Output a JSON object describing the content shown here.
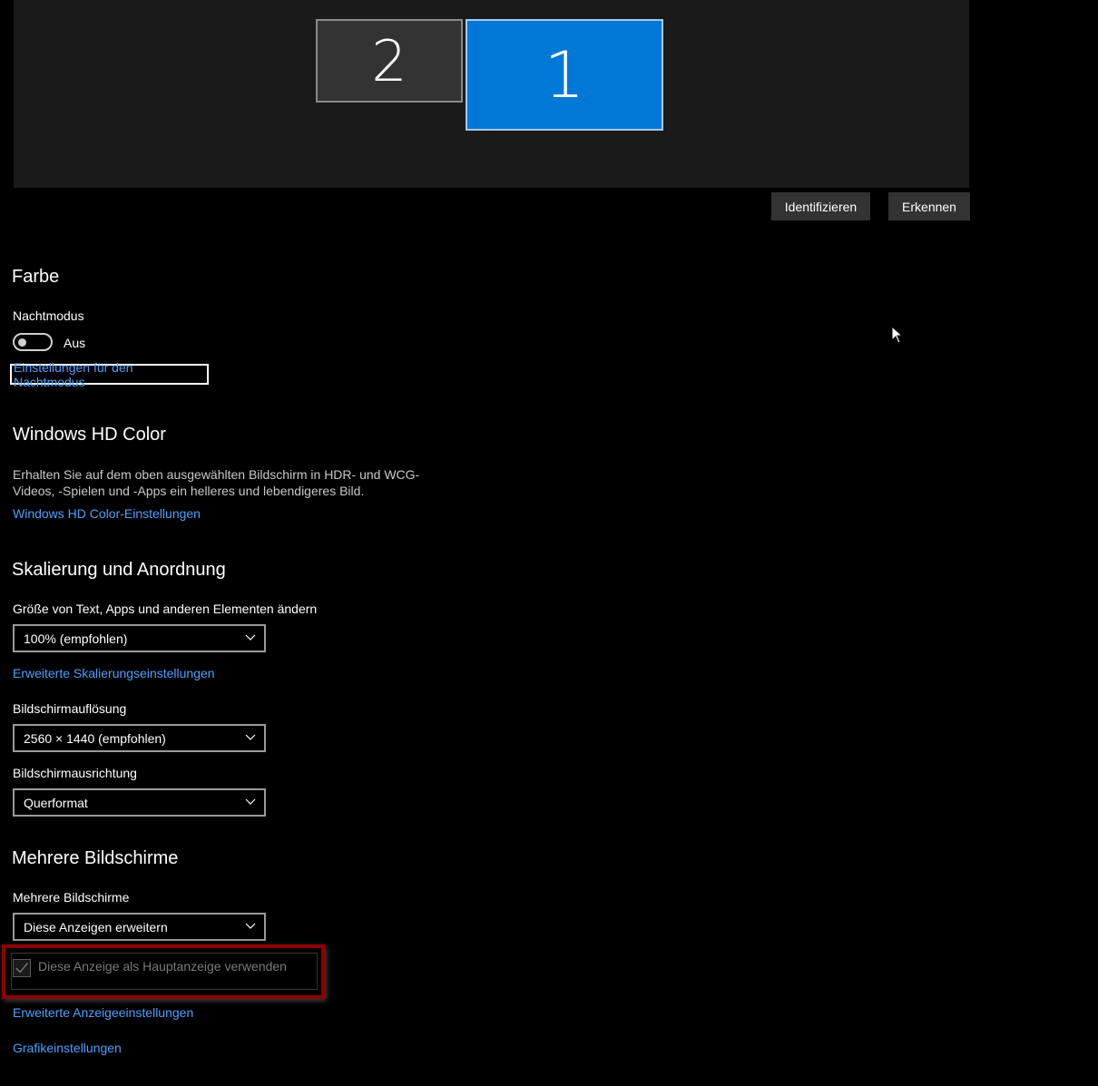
{
  "display": {
    "monitors": [
      {
        "number": "2",
        "selected": false
      },
      {
        "number": "1",
        "selected": true
      }
    ],
    "identify_label": "Identifizieren",
    "detect_label": "Erkennen"
  },
  "color": {
    "heading": "Farbe",
    "night_mode_label": "Nachtmodus",
    "night_mode_state": "Aus",
    "night_mode_on": false,
    "night_mode_settings_link": "Einstellungen für den Nachtmodus"
  },
  "hd_color": {
    "heading": "Windows HD Color",
    "description_line1": "Erhalten Sie auf dem oben ausgewählten Bildschirm in HDR- und WCG-",
    "description_line2": "Videos, -Spielen und -Apps ein helleres und lebendigeres Bild.",
    "settings_link": "Windows HD Color-Einstellungen"
  },
  "scaling": {
    "heading": "Skalierung und Anordnung",
    "size_label": "Größe von Text, Apps und anderen Elementen ändern",
    "size_value": "100% (empfohlen)",
    "advanced_link": "Erweiterte Skalierungseinstellungen",
    "resolution_label": "Bildschirmauflösung",
    "resolution_value": "2560 × 1440 (empfohlen)",
    "orientation_label": "Bildschirmausrichtung",
    "orientation_value": "Querformat"
  },
  "multiple": {
    "heading": "Mehrere Bildschirme",
    "label": "Mehrere Bildschirme",
    "value": "Diese Anzeigen erweitern",
    "main_display_checkbox_label": "Diese Anzeige als Hauptanzeige verwenden",
    "main_display_checked": true,
    "main_display_enabled": false,
    "advanced_display_link": "Erweiterte Anzeigeeinstellungen",
    "graphics_link": "Grafikeinstellungen"
  },
  "colors": {
    "accent": "#0078d7",
    "link": "#4ba0ff",
    "highlight_border": "#8e0000"
  }
}
